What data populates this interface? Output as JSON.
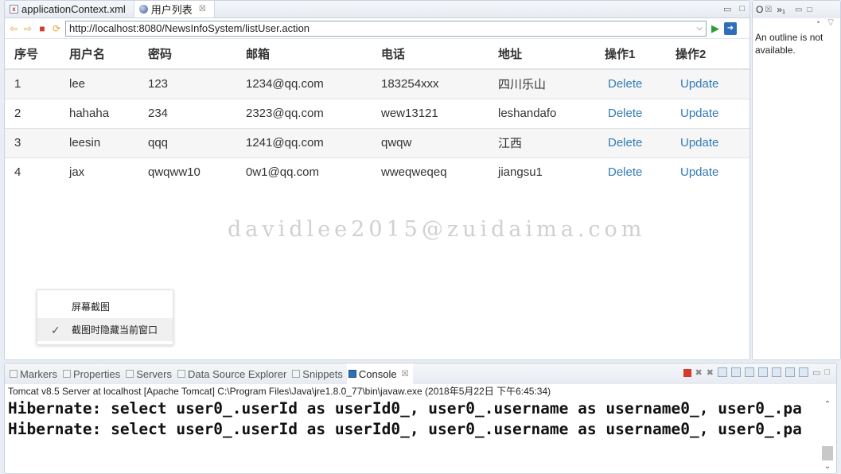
{
  "editor": {
    "tabs": [
      {
        "label": "applicationContext.xml",
        "icon": "xml-file-icon",
        "active": false
      },
      {
        "label": "用户列表",
        "icon": "globe-icon",
        "active": true,
        "close": "☒"
      }
    ]
  },
  "browser": {
    "url": "http://localhost:8080/NewsInfoSystem/listUser.action"
  },
  "table": {
    "headers": [
      "序号",
      "用户名",
      "密码",
      "邮箱",
      "电话",
      "地址",
      "操作1",
      "操作2"
    ],
    "rows": [
      {
        "id": "1",
        "username": "lee",
        "password": "123",
        "email": "1234@qq.com",
        "phone": "183254xxx",
        "address": "四川乐山",
        "op1": "Delete",
        "op2": "Update"
      },
      {
        "id": "2",
        "username": "hahaha",
        "password": "234",
        "email": "2323@qq.com",
        "phone": "wew13121",
        "address": "leshandafo",
        "op1": "Delete",
        "op2": "Update"
      },
      {
        "id": "3",
        "username": "leesin",
        "password": "qqq",
        "email": "1241@qq.com",
        "phone": "qwqw",
        "address": "江西",
        "op1": "Delete",
        "op2": "Update"
      },
      {
        "id": "4",
        "username": "jax",
        "password": "qwqww10",
        "email": "0w1@qq.com",
        "phone": "wweqweqeq",
        "address": "jiangsu1",
        "op1": "Delete",
        "op2": "Update"
      }
    ]
  },
  "watermark": "davidlee2015@zuidaima.com",
  "context_menu": {
    "items": [
      {
        "label": "屏幕截图",
        "checked": false
      },
      {
        "label": "截图时隐藏当前窗口",
        "checked": true
      }
    ]
  },
  "outline": {
    "tab_label": "O",
    "overflow": "»₁",
    "message": "An outline is not available."
  },
  "console": {
    "tabs": [
      {
        "label": "Markers",
        "active": false
      },
      {
        "label": "Properties",
        "active": false
      },
      {
        "label": "Servers",
        "active": false
      },
      {
        "label": "Data Source Explorer",
        "active": false
      },
      {
        "label": "Snippets",
        "active": false
      },
      {
        "label": "Console",
        "active": true
      }
    ],
    "description": "Tomcat v8.5 Server at localhost [Apache Tomcat] C:\\Program Files\\Java\\jre1.8.0_77\\bin\\javaw.exe (2018年5月22日 下午6:45:34)",
    "lines": [
      "Hibernate: select user0_.userId as userId0_, user0_.username as username0_, user0_.pa",
      "Hibernate: select user0_.userId as userId0_, user0_.username as username0_, user0_.pa"
    ]
  },
  "colors": {
    "link": "#337ab7",
    "stripe": "#f6f6f6",
    "accent": "#2d6fb8"
  }
}
